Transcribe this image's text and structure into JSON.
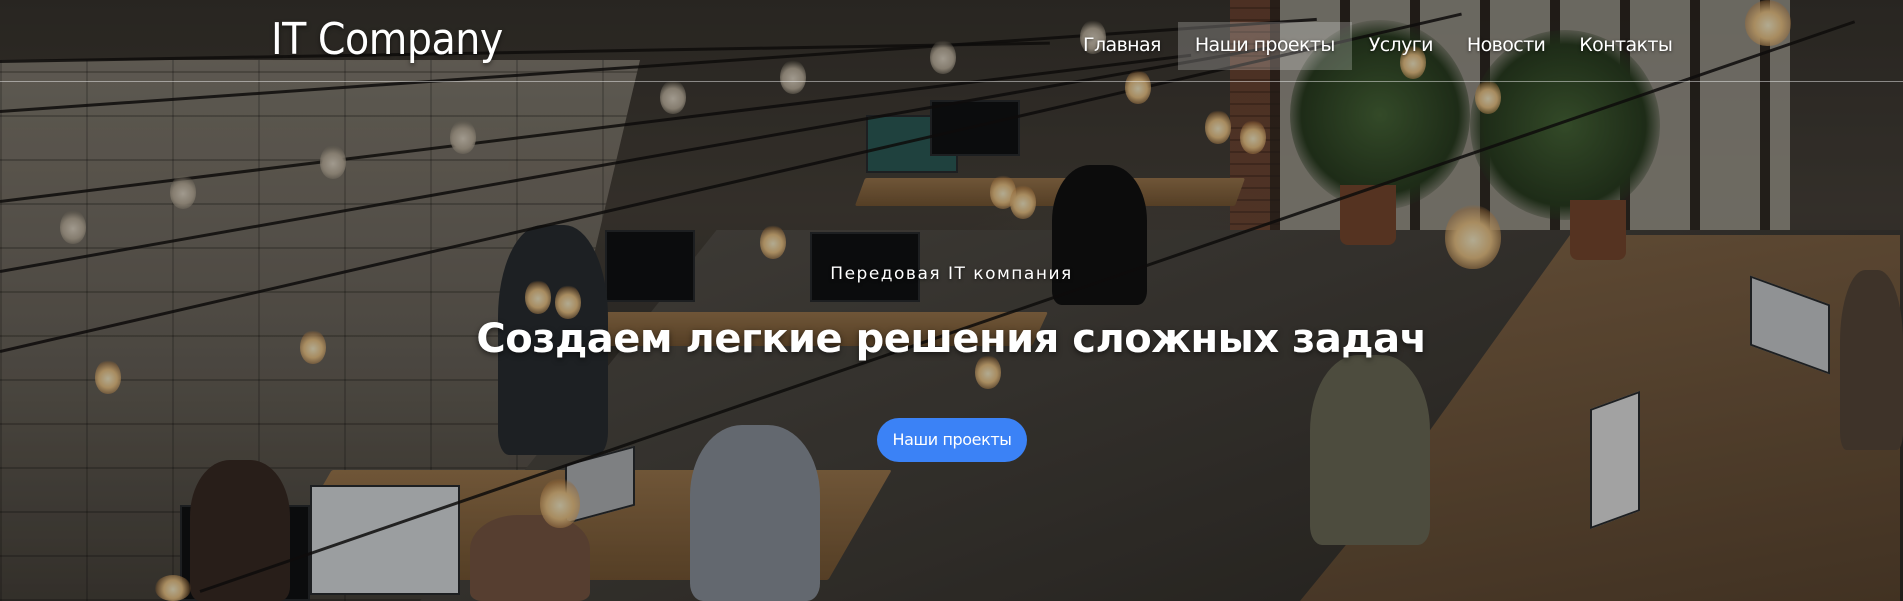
{
  "brand": {
    "logo_text": "IT Company"
  },
  "nav": {
    "items": [
      {
        "label": "Главная",
        "active": false
      },
      {
        "label": "Наши проекты",
        "active": true
      },
      {
        "label": "Услуги",
        "active": false
      },
      {
        "label": "Новости",
        "active": false
      },
      {
        "label": "Контакты",
        "active": false
      }
    ]
  },
  "hero": {
    "subtitle": "Передовая IT компания",
    "headline": "Создаем легкие решения сложных задач",
    "cta_label": "Наши проекты",
    "background_image": "office-workspace-with-string-lights-photo"
  },
  "colors": {
    "accent": "#3b82f6",
    "text": "#ffffff",
    "active_nav_bg": "rgba(255,255,255,0.22)"
  }
}
